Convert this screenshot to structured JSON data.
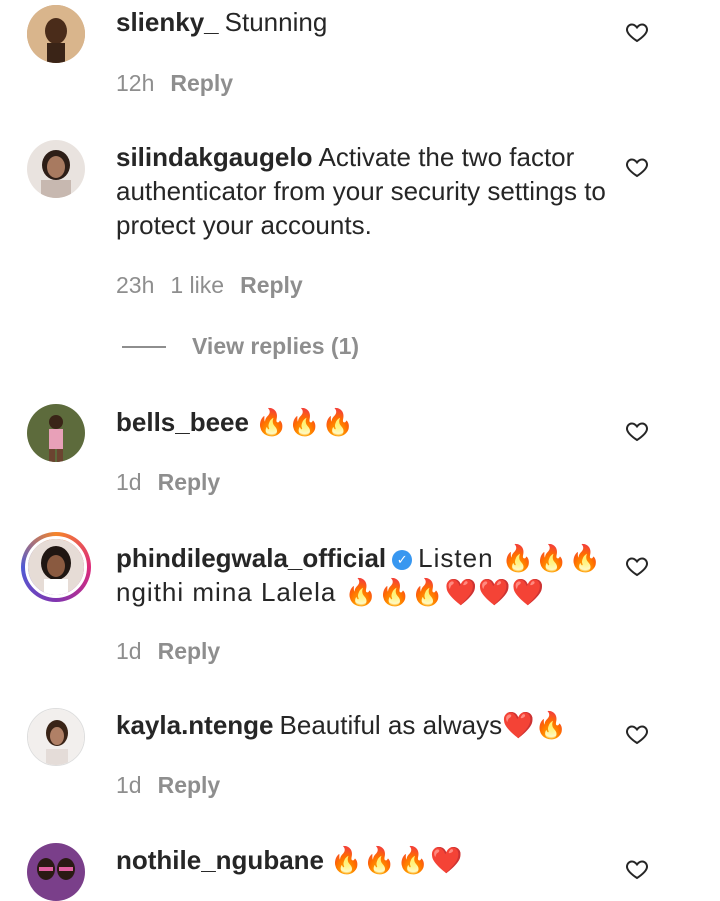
{
  "comments": [
    {
      "username": "slienky_",
      "text": "Stunning",
      "time": "12h",
      "likes": "",
      "reply": "Reply",
      "avatar_color": "#c9a07a"
    },
    {
      "username": "silindakgaugelo",
      "text": "Activate the two factor authenticator from your security settings to protect your accounts.",
      "time": "23h",
      "likes": "1 like",
      "reply": "Reply",
      "avatar_color": "#8a6b59"
    },
    {
      "username": "bells_beee",
      "text": "🔥🔥🔥",
      "time": "1d",
      "likes": "",
      "reply": "Reply",
      "avatar_color": "#6b5a3a"
    },
    {
      "username": "phindilegwala_official",
      "verified": true,
      "text": "Listen 🔥🔥🔥 ngithi mina Lalela 🔥🔥🔥❤️❤️❤️",
      "time": "1d",
      "likes": "",
      "reply": "Reply",
      "avatar_color": "#4a3a30"
    },
    {
      "username": "kayla.ntenge",
      "text": "Beautiful as always❤️🔥",
      "time": "1d",
      "likes": "",
      "reply": "Reply",
      "avatar_color": "#e8e4e2"
    },
    {
      "username": "nothile_ngubane",
      "text": "🔥🔥🔥❤️",
      "time": "",
      "likes": "",
      "reply": "",
      "avatar_color": "#7a3f8a"
    }
  ],
  "view_replies": "View replies (1)",
  "icons": {
    "like": "heart-outline-icon"
  },
  "colors": {
    "secondary_text": "#8e8e8e",
    "primary_text": "#262626",
    "verified": "#3897f0"
  }
}
